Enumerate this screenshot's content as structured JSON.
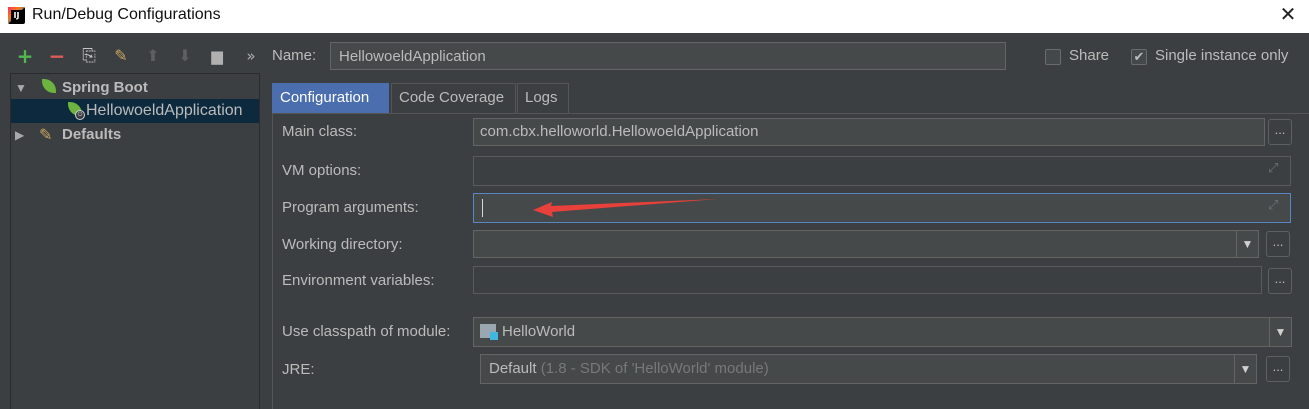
{
  "window": {
    "title": "Run/Debug Configurations",
    "app_icon_text": "IJ"
  },
  "toolbar": {
    "add": "+",
    "remove": "−",
    "copy": "⎘",
    "edit_defaults": "✎",
    "move_up": "⬆",
    "move_down": "⬇",
    "folder": "▆",
    "more": "»"
  },
  "tree": {
    "group_label": "Spring Boot",
    "item_label": "HellowoeldApplication",
    "defaults_label": "Defaults"
  },
  "name": {
    "label": "Name:",
    "value": "HellowoeldApplication"
  },
  "options": {
    "share_label": "Share",
    "share_checked": false,
    "single_instance_label": "Single instance only",
    "single_instance_checked": true
  },
  "tabs": [
    {
      "label": "Configuration",
      "active": true
    },
    {
      "label": "Code Coverage",
      "active": false
    },
    {
      "label": "Logs",
      "active": false
    }
  ],
  "form": {
    "main_class": {
      "label": "Main class:",
      "value": "com.cbx.helloworld.HellowoeldApplication"
    },
    "vm_options": {
      "label": "VM options:",
      "value": ""
    },
    "program_arguments": {
      "label": "Program arguments:",
      "value": ""
    },
    "working_directory": {
      "label": "Working directory:",
      "value": ""
    },
    "environment_variables": {
      "label": "Environment variables:",
      "value": ""
    },
    "classpath_module": {
      "label": "Use classpath of module:",
      "value": "HelloWorld"
    },
    "jre": {
      "label": "JRE:",
      "value": "Default",
      "detail": "(1.8 - SDK of 'HelloWorld' module)"
    }
  },
  "buttons": {
    "browse": "...",
    "dropdown": "▼",
    "expand": "⤢",
    "close": "✕"
  },
  "colors": {
    "background": "#3c3f41",
    "active_tab": "#4b6eaf",
    "selection": "#0d293e",
    "spring_green": "#6db33f",
    "annotation_arrow": "#e8403a"
  }
}
